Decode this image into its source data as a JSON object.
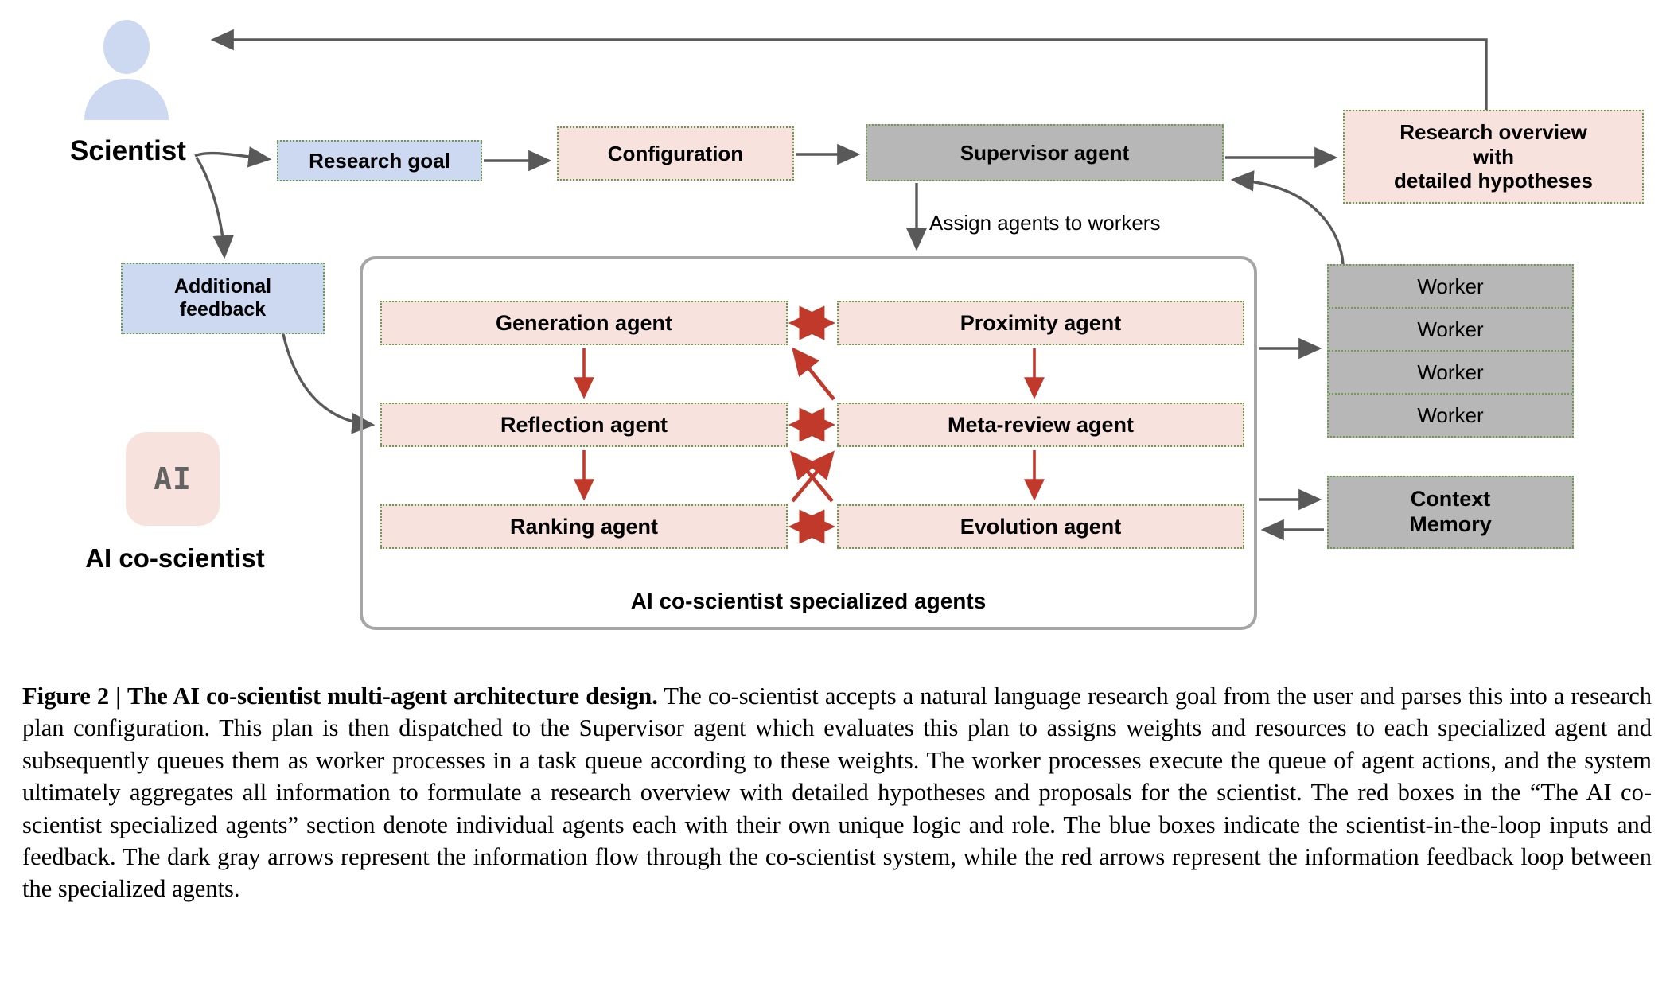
{
  "figure": {
    "scientist_label": "Scientist",
    "ai_logo_text": "AI",
    "ai_caption": "AI co-scientist",
    "assign_label": "Assign agents to workers",
    "container_label": "AI co-scientist specialized agents"
  },
  "nodes": {
    "research_goal": "Research goal",
    "configuration": "Configuration",
    "supervisor": "Supervisor agent",
    "research_overview_line1": "Research overview",
    "research_overview_line2": "with",
    "research_overview_line3": "detailed hypotheses",
    "additional_feedback_line1": "Additional",
    "additional_feedback_line2": "feedback",
    "context_memory_line1": "Context",
    "context_memory_line2": "Memory"
  },
  "workers": [
    "Worker",
    "Worker",
    "Worker",
    "Worker"
  ],
  "agents": {
    "generation": "Generation agent",
    "proximity": "Proximity  agent",
    "reflection": "Reflection agent",
    "meta_review": "Meta-review agent",
    "ranking": "Ranking agent",
    "evolution": "Evolution agent"
  },
  "colors": {
    "pink": "#f8e2de",
    "blue": "#ccd9f0",
    "gray": "#b7b7b7",
    "dotted_border": "#6f9a4e",
    "flow_arrow": "#595959",
    "feedback_arrow": "#c0392b",
    "container_border": "#a6a6a6"
  },
  "caption": {
    "label": "Figure 2",
    "separator": "|",
    "title": "The AI co-scientist multi-agent architecture design.",
    "body": "The co-scientist accepts a natural language research goal from the user and parses this into a research plan configuration. This plan is then dispatched to the Supervisor agent which evaluates this plan to assigns weights and resources to each specialized agent and subsequently queues them as worker processes in a task queue according to these weights. The worker processes execute the queue of agent actions, and the system ultimately aggregates all information to formulate a research overview with detailed hypotheses and proposals for the scientist. The red boxes in the “The AI co-scientist specialized agents” section denote individual agents each with their own unique logic and role. The blue boxes indicate the scientist-in-the-loop inputs and feedback. The dark gray arrows represent the information flow through the co-scientist system, while the red arrows represent the information feedback loop between the specialized agents."
  }
}
